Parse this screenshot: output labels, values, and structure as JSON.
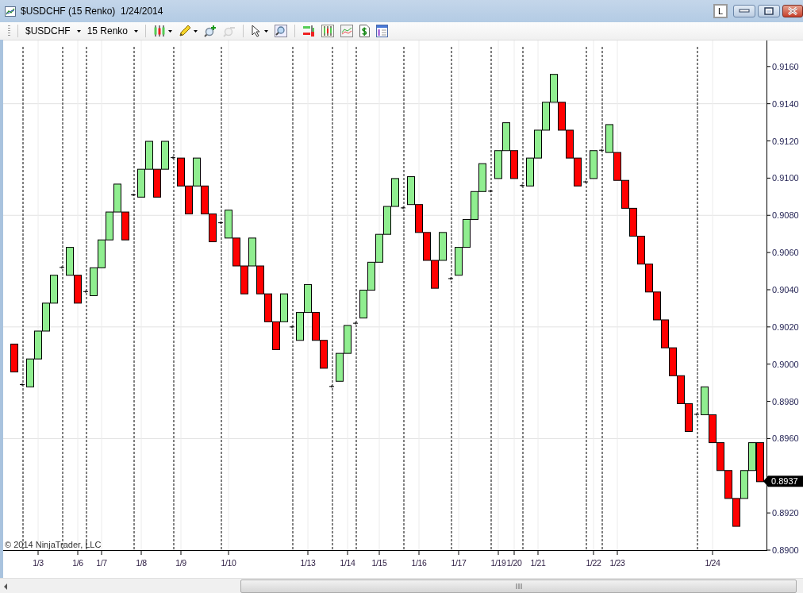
{
  "window": {
    "title": "$USDCHF (15 Renko)  1/24/2014",
    "layout_button": "L"
  },
  "toolbar": {
    "instrument": "$USDCHF",
    "period": "15 Renko",
    "tool_groups": [
      [
        {
          "kind": "candles",
          "caret": true,
          "disabled": false
        },
        {
          "kind": "pencil",
          "caret": true,
          "disabled": false
        },
        {
          "kind": "zoom-in",
          "caret": false,
          "disabled": false
        },
        {
          "kind": "zoom-out",
          "caret": false,
          "disabled": true
        }
      ],
      [
        {
          "kind": "pointer",
          "caret": true,
          "disabled": false
        },
        {
          "kind": "zoom-box",
          "caret": false,
          "disabled": false
        }
      ],
      [
        {
          "kind": "bars",
          "caret": false,
          "disabled": false
        },
        {
          "kind": "candle-chart",
          "caret": false,
          "disabled": false
        },
        {
          "kind": "line-chart",
          "caret": false,
          "disabled": false
        },
        {
          "kind": "dollar",
          "caret": false,
          "disabled": false
        },
        {
          "kind": "properties",
          "caret": false,
          "disabled": false
        }
      ]
    ]
  },
  "chart": {
    "copyright": "© 2014 NinjaTrader, LLC",
    "current_price": "0.8937",
    "chart_data": {
      "type": "candlestick",
      "grid": true,
      "categories": [
        null,
        null,
        null,
        "1/3",
        null,
        null,
        null,
        null,
        "1/6",
        null,
        null,
        "1/7",
        null,
        null,
        null,
        null,
        "1/8",
        null,
        null,
        null,
        null,
        "1/9",
        null,
        null,
        null,
        null,
        null,
        "1/10",
        null,
        null,
        null,
        null,
        null,
        null,
        null,
        null,
        null,
        "1/13",
        null,
        null,
        null,
        null,
        "1/14",
        null,
        null,
        null,
        "1/15",
        null,
        null,
        null,
        null,
        "1/16",
        null,
        null,
        null,
        null,
        "1/17",
        null,
        null,
        null,
        null,
        "1/19",
        null,
        "1/20",
        null,
        null,
        "1/21",
        null,
        null,
        null,
        null,
        null,
        null,
        "1/22",
        null,
        null,
        "1/23",
        null,
        null,
        null,
        null,
        null,
        null,
        null,
        null,
        null,
        null,
        null,
        "1/24",
        null,
        null,
        null,
        null,
        null,
        null
      ],
      "ylim": [
        0.89,
        0.9174
      ],
      "series": [
        {
          "ohlc": [
            [
              0.9011,
              0.9011,
              0.8996,
              0.8996
            ],
            null,
            [
              0.8988,
              0.9003,
              0.8988,
              0.9003
            ],
            [
              0.9003,
              0.9018,
              0.9003,
              0.9018
            ],
            [
              0.9018,
              0.9033,
              0.9018,
              0.9033
            ],
            [
              0.9033,
              0.9048,
              0.9033,
              0.9048
            ],
            null,
            [
              0.9048,
              0.9063,
              0.9048,
              0.9063
            ],
            [
              0.9048,
              0.9048,
              0.9033,
              0.9033
            ],
            null,
            [
              0.9037,
              0.9052,
              0.9037,
              0.9052
            ],
            [
              0.9052,
              0.9067,
              0.9052,
              0.9067
            ],
            [
              0.9067,
              0.9082,
              0.9067,
              0.9082
            ],
            [
              0.9082,
              0.9097,
              0.9082,
              0.9097
            ],
            [
              0.9082,
              0.9082,
              0.9067,
              0.9067
            ],
            null,
            [
              0.909,
              0.9105,
              0.909,
              0.9105
            ],
            [
              0.9105,
              0.912,
              0.9105,
              0.912
            ],
            [
              0.9105,
              0.9105,
              0.909,
              0.909
            ],
            [
              0.9105,
              0.912,
              0.9105,
              0.912
            ],
            null,
            [
              0.9111,
              0.9111,
              0.9096,
              0.9096
            ],
            [
              0.9096,
              0.9096,
              0.9081,
              0.9081
            ],
            [
              0.9096,
              0.9111,
              0.9096,
              0.9111
            ],
            [
              0.9096,
              0.9096,
              0.9081,
              0.9081
            ],
            [
              0.9081,
              0.9081,
              0.9066,
              0.9066
            ],
            null,
            [
              0.9068,
              0.9083,
              0.9068,
              0.9083
            ],
            [
              0.9068,
              0.9068,
              0.9053,
              0.9053
            ],
            [
              0.9053,
              0.9053,
              0.9038,
              0.9038
            ],
            [
              0.9053,
              0.9068,
              0.9053,
              0.9068
            ],
            [
              0.9053,
              0.9053,
              0.9038,
              0.9038
            ],
            [
              0.9038,
              0.9038,
              0.9023,
              0.9023
            ],
            [
              0.9023,
              0.9023,
              0.9008,
              0.9008
            ],
            [
              0.9023,
              0.9038,
              0.9023,
              0.9038
            ],
            null,
            [
              0.9013,
              0.9028,
              0.9013,
              0.9028
            ],
            [
              0.9028,
              0.9043,
              0.9028,
              0.9043
            ],
            [
              0.9028,
              0.9028,
              0.9013,
              0.9013
            ],
            [
              0.9013,
              0.9013,
              0.8998,
              0.8998
            ],
            null,
            [
              0.8991,
              0.9006,
              0.8991,
              0.9006
            ],
            [
              0.9006,
              0.9021,
              0.9006,
              0.9021
            ],
            null,
            [
              0.9025,
              0.904,
              0.9025,
              0.904
            ],
            [
              0.904,
              0.9055,
              0.904,
              0.9055
            ],
            [
              0.9055,
              0.907,
              0.9055,
              0.907
            ],
            [
              0.907,
              0.9085,
              0.907,
              0.9085
            ],
            [
              0.9085,
              0.91,
              0.9085,
              0.91
            ],
            null,
            [
              0.9086,
              0.9101,
              0.9086,
              0.9101
            ],
            [
              0.9086,
              0.9086,
              0.9071,
              0.9071
            ],
            [
              0.9071,
              0.9071,
              0.9056,
              0.9056
            ],
            [
              0.9056,
              0.9056,
              0.9041,
              0.9041
            ],
            [
              0.9056,
              0.9071,
              0.9056,
              0.9071
            ],
            null,
            [
              0.9048,
              0.9063,
              0.9048,
              0.9063
            ],
            [
              0.9063,
              0.9078,
              0.9063,
              0.9078
            ],
            [
              0.9078,
              0.9093,
              0.9078,
              0.9093
            ],
            [
              0.9093,
              0.9108,
              0.9093,
              0.9108
            ],
            null,
            [
              0.91,
              0.9115,
              0.91,
              0.9115
            ],
            [
              0.9115,
              0.913,
              0.9115,
              0.913
            ],
            [
              0.9115,
              0.9115,
              0.91,
              0.91
            ],
            null,
            [
              0.9096,
              0.9111,
              0.9096,
              0.9111
            ],
            [
              0.9111,
              0.9126,
              0.9111,
              0.9126
            ],
            [
              0.9126,
              0.9141,
              0.9126,
              0.9141
            ],
            [
              0.9141,
              0.9156,
              0.9141,
              0.9156
            ],
            [
              0.9141,
              0.9141,
              0.9126,
              0.9126
            ],
            [
              0.9126,
              0.9126,
              0.9111,
              0.9111
            ],
            [
              0.9111,
              0.9111,
              0.9096,
              0.9096
            ],
            null,
            [
              0.91,
              0.9115,
              0.91,
              0.9115
            ],
            null,
            [
              0.9114,
              0.9129,
              0.9114,
              0.9129
            ],
            [
              0.9114,
              0.9114,
              0.9099,
              0.9099
            ],
            [
              0.9099,
              0.9099,
              0.9084,
              0.9084
            ],
            [
              0.9084,
              0.9084,
              0.9069,
              0.9069
            ],
            [
              0.9069,
              0.9069,
              0.9054,
              0.9054
            ],
            [
              0.9054,
              0.9054,
              0.9039,
              0.9039
            ],
            [
              0.9039,
              0.9039,
              0.9024,
              0.9024
            ],
            [
              0.9024,
              0.9024,
              0.9009,
              0.9009
            ],
            [
              0.9009,
              0.9009,
              0.8994,
              0.8994
            ],
            [
              0.8994,
              0.8994,
              0.8979,
              0.8979
            ],
            [
              0.8979,
              0.8979,
              0.8964,
              0.8964
            ],
            null,
            [
              0.8973,
              0.8988,
              0.8973,
              0.8988
            ],
            [
              0.8973,
              0.8973,
              0.8958,
              0.8958
            ],
            [
              0.8958,
              0.8958,
              0.8943,
              0.8943
            ],
            [
              0.8943,
              0.8943,
              0.8928,
              0.8928
            ],
            [
              0.8928,
              0.8928,
              0.8913,
              0.8913
            ],
            [
              0.8928,
              0.8943,
              0.8928,
              0.8943
            ],
            [
              0.8943,
              0.8958,
              0.8943,
              0.8958
            ],
            [
              0.8958,
              0.8958,
              0.8937,
              0.8937
            ]
          ]
        },
        {
          "type": "scatter",
          "values": [
            null,
            0.8989,
            null,
            null,
            null,
            null,
            0.9052,
            null,
            null,
            0.9039,
            null,
            null,
            null,
            null,
            null,
            0.9091,
            null,
            null,
            null,
            null,
            0.9111,
            null,
            null,
            null,
            null,
            null,
            0.9076,
            null,
            null,
            null,
            null,
            null,
            null,
            null,
            null,
            0.902,
            null,
            null,
            null,
            null,
            0.8988,
            null,
            null,
            0.9022,
            null,
            null,
            null,
            null,
            null,
            0.9084,
            null,
            null,
            null,
            null,
            null,
            0.9046,
            null,
            null,
            null,
            null,
            0.9093,
            null,
            null,
            null,
            0.9096,
            null,
            null,
            null,
            null,
            null,
            null,
            null,
            0.9098,
            null,
            0.9115,
            null,
            null,
            null,
            null,
            null,
            null,
            null,
            null,
            null,
            null,
            null,
            0.8973,
            null,
            null,
            null,
            null,
            null,
            null,
            null,
            null
          ]
        }
      ],
      "yticks": [
        {
          "value": 0.89,
          "label": "0.8900"
        },
        {
          "value": 0.892,
          "label": "0.8920"
        },
        {
          "value": 0.896,
          "label": "0.8960"
        },
        {
          "value": 0.898,
          "label": "0.8980"
        },
        {
          "value": 0.9,
          "label": "0.9000"
        },
        {
          "value": 0.902,
          "label": "0.9020"
        },
        {
          "value": 0.904,
          "label": "0.9040"
        },
        {
          "value": 0.906,
          "label": "0.9060"
        },
        {
          "value": 0.908,
          "label": "0.9080"
        },
        {
          "value": 0.91,
          "label": "0.9100"
        },
        {
          "value": 0.912,
          "label": "0.9120"
        },
        {
          "value": 0.914,
          "label": "0.9140"
        },
        {
          "value": 0.916,
          "label": "0.9160"
        }
      ]
    }
  }
}
